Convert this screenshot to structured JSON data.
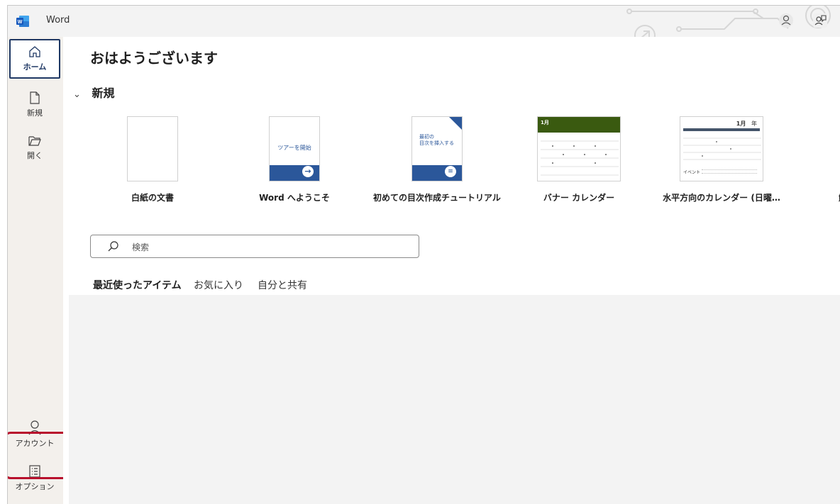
{
  "titlebar": {
    "app_name": "Word"
  },
  "sidebar": {
    "home_label": "ホーム",
    "new_label": "新規",
    "open_label": "開く",
    "account_label": "アカウント",
    "options_label": "オプション"
  },
  "main": {
    "greeting": "おはようございます",
    "new_section": "新規",
    "templates": [
      {
        "name": "白紙の文書"
      },
      {
        "name": "Word へようこそ",
        "thumb_text": "ツアーを開始"
      },
      {
        "name": "初めての目次作成チュートリアル",
        "thumb_text_1": "最初の",
        "thumb_text_2": "目次を挿入する"
      },
      {
        "name": "バナー カレンダー",
        "thumb_month": "1月"
      },
      {
        "name": "水平方向のカレンダー (日曜…",
        "thumb_month": "1月",
        "thumb_year": "年",
        "thumb_event": "イベント"
      },
      {
        "name": "鮮明な["
      }
    ],
    "search_placeholder": "検索",
    "tabs": [
      "最近使ったアイテム",
      "お気に入り",
      "自分と共有"
    ]
  },
  "colors": {
    "accent": "#1f3864",
    "highlight": "#b8102c",
    "banner_green": "#3a5a10",
    "tpl_blue": "#2b579a"
  }
}
